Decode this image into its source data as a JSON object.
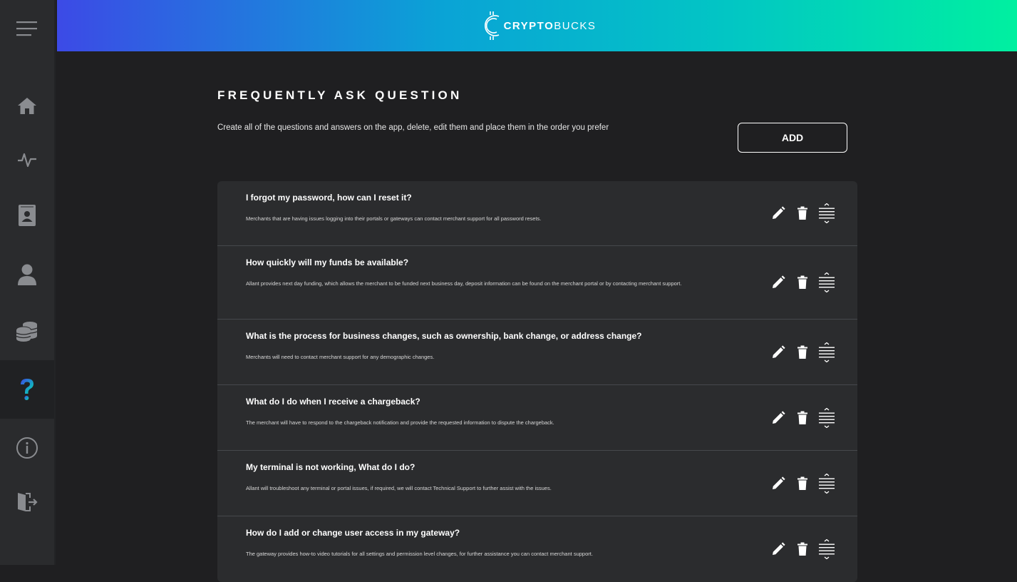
{
  "app": {
    "logo_text_strong": "CRYPTO",
    "logo_text_light": "BUCKS"
  },
  "sidebar": {
    "menu_icon": "hamburger-menu-icon",
    "items": [
      {
        "icon": "home-icon",
        "active": false
      },
      {
        "icon": "activity-pulse-icon",
        "active": false
      },
      {
        "icon": "contacts-book-icon",
        "active": false
      },
      {
        "icon": "user-icon",
        "active": false
      },
      {
        "icon": "coins-stack-icon",
        "active": false
      },
      {
        "icon": "question-mark-icon",
        "active": true
      },
      {
        "icon": "info-icon",
        "active": false
      },
      {
        "icon": "logout-door-icon",
        "active": false
      }
    ]
  },
  "page": {
    "title": "FREQUENTLY ASK QUESTION",
    "description": "Create all of the questions and answers on the app, delete, edit them and place them in the order you prefer",
    "add_label": "ADD"
  },
  "faqs": [
    {
      "question": "I forgot my password, how can I reset it?",
      "answer": "Merchants that are having issues logging into their portals or gateways can contact merchant support for all password resets."
    },
    {
      "question": "How quickly will my funds be available?",
      "answer": "Allant provides next day funding, which allows the merchant to be funded next business day, deposit information can be found on the merchant portal or by contacting merchant support."
    },
    {
      "question": "What is the process for business changes, such as ownership, bank change, or address change?",
      "answer": "Merchants will need to contact merchant support for any demographic changes."
    },
    {
      "question": "What do I do when I receive a chargeback?",
      "answer": "The merchant will have to respond to the chargeback notification and provide the requested information to dispute the chargeback."
    },
    {
      "question": "My terminal is not working, What do I do?",
      "answer": "Allant will troubleshoot any terminal or portal issues, if required, we will contact Technical Support to further assist with the issues."
    },
    {
      "question": "How do I add or change user access in my gateway?",
      "answer": "The gateway provides how-to video tutorials for all settings and permission level changes, for further assistance you can contact merchant support."
    }
  ],
  "colors": {
    "accent_active_icon": "#2fb8e6",
    "sidebar_icon": "#8a8c90",
    "header_gradient_start": "#3c4ae6",
    "header_gradient_end": "#00f0a0"
  }
}
